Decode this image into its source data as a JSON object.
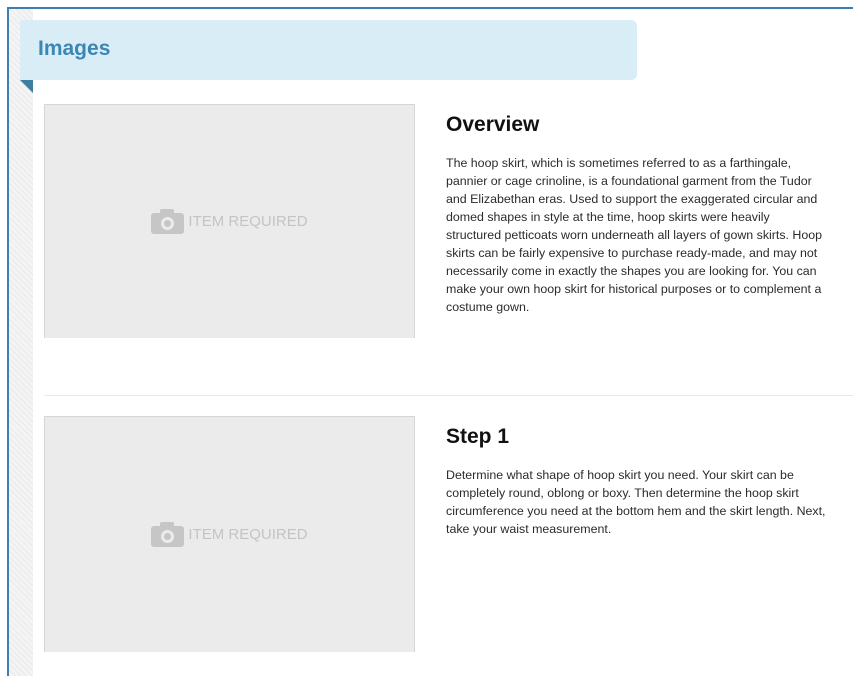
{
  "section": {
    "title": "Images"
  },
  "steps": [
    {
      "heading": "Overview",
      "body": "The hoop skirt, which is sometimes referred to as a farthingale, pannier or cage crinoline, is a foundational garment from the Tudor and Elizabethan eras. Used to support the exaggerated circular and domed shapes in style at the time, hoop skirts were heavily structured petticoats worn underneath all layers of gown skirts. Hoop skirts can be fairly expensive to purchase ready-made, and may not necessarily come in exactly the shapes you are looking for. You can make your own hoop skirt for historical purposes or to complement a costume gown.",
      "image_placeholder": {
        "icon": "camera-icon",
        "label": "ITEM REQUIRED"
      }
    },
    {
      "heading": "Step 1",
      "body": "Determine what shape of hoop skirt you need. Your skirt can be completely round, oblong or boxy. Then determine the hoop skirt circumference you need at the bottom hem and the skirt length. Next, take your waist measurement.",
      "image_placeholder": {
        "icon": "camera-icon",
        "label": "ITEM REQUIRED"
      }
    }
  ],
  "colors": {
    "frame_border": "#3d7fb5",
    "banner_background": "#d9edf7",
    "banner_text": "#3a87b5",
    "placeholder_background": "#ebebeb",
    "placeholder_text": "#c4c4c4"
  }
}
